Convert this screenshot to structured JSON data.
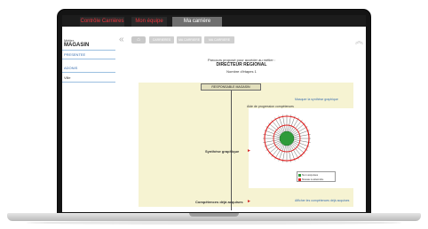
{
  "tabs": {
    "contacts": "Contrôle Carrières",
    "team": "Mon équipe",
    "career": "Ma carrière"
  },
  "sidebar": {
    "role_small": "Métier",
    "title": "MAGASIN",
    "link1": "PRESENTEE",
    "link2": "ADONIS",
    "text3": "Ville"
  },
  "breadcrumb": {
    "items": [
      "CARRIERES",
      "MA CARRIERE",
      "MA CARRIERE"
    ]
  },
  "content": {
    "intro": "Parcours proposé pour accéder au métier :",
    "job_title": "DIRECTEUR REGIONAL",
    "steps": "Nombre d'étapes 1",
    "origin_job": "RESPONSABLE MAGASIN",
    "graph_link": "Masquer la synthèse graphique",
    "chart_title": "Aide de progression compétences",
    "section_graph": "Synthèse graphique",
    "section_skills": "Compétences déjà acquises",
    "skills_link": "Afficher les compétences déjà acquises",
    "legend_ok": "Non acquises",
    "legend_todo": "Niveau à atteindre"
  },
  "colors": {
    "accent_red": "#e8323b",
    "link_blue": "#3a6fb0",
    "panel": "#f6f3d2"
  }
}
